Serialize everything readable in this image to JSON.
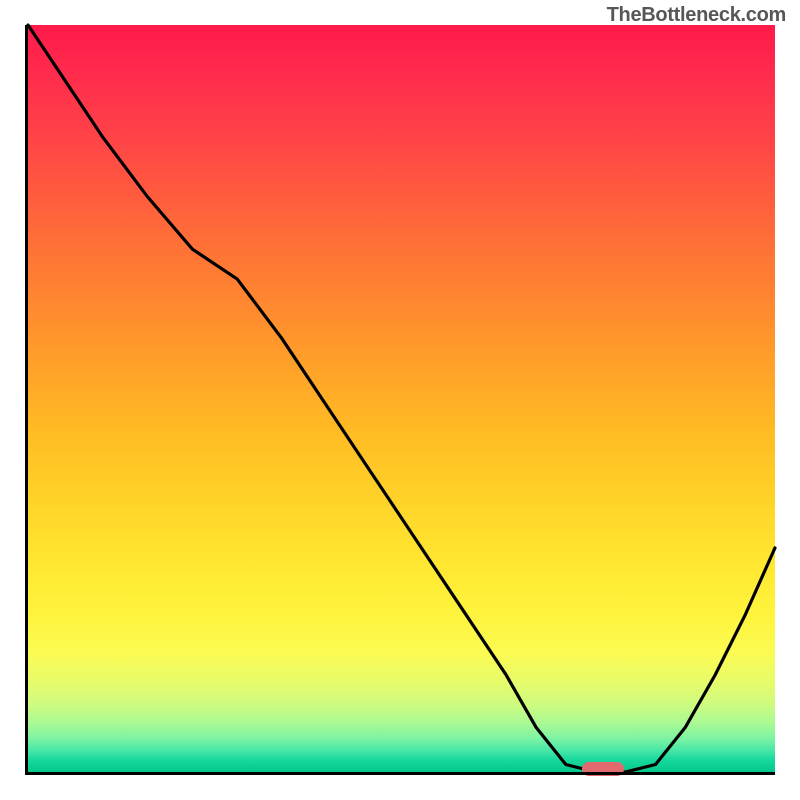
{
  "watermark": "TheBottleneck.com",
  "chart_data": {
    "type": "line",
    "title": "",
    "xlabel": "",
    "ylabel": "",
    "xlim": [
      0,
      100
    ],
    "ylim": [
      0,
      100
    ],
    "grid": false,
    "legend": false,
    "background_gradient": {
      "top_color": "#ff1a4a",
      "bottom_color": "#00c88c",
      "description": "red-to-green vertical gradient (bottleneck severity scale)"
    },
    "series": [
      {
        "name": "bottleneck-curve",
        "x": [
          0,
          4,
          10,
          16,
          22,
          28,
          34,
          40,
          46,
          52,
          58,
          64,
          68,
          72,
          76,
          80,
          84,
          88,
          92,
          96,
          100
        ],
        "values": [
          100,
          94,
          85,
          77,
          70,
          66,
          58,
          49,
          40,
          31,
          22,
          13,
          6,
          1,
          0,
          0,
          1,
          6,
          13,
          21,
          30
        ]
      }
    ],
    "marker": {
      "x": 77,
      "y": 0,
      "color": "#e16a6f",
      "shape": "pill",
      "description": "optimal configuration marker"
    }
  }
}
